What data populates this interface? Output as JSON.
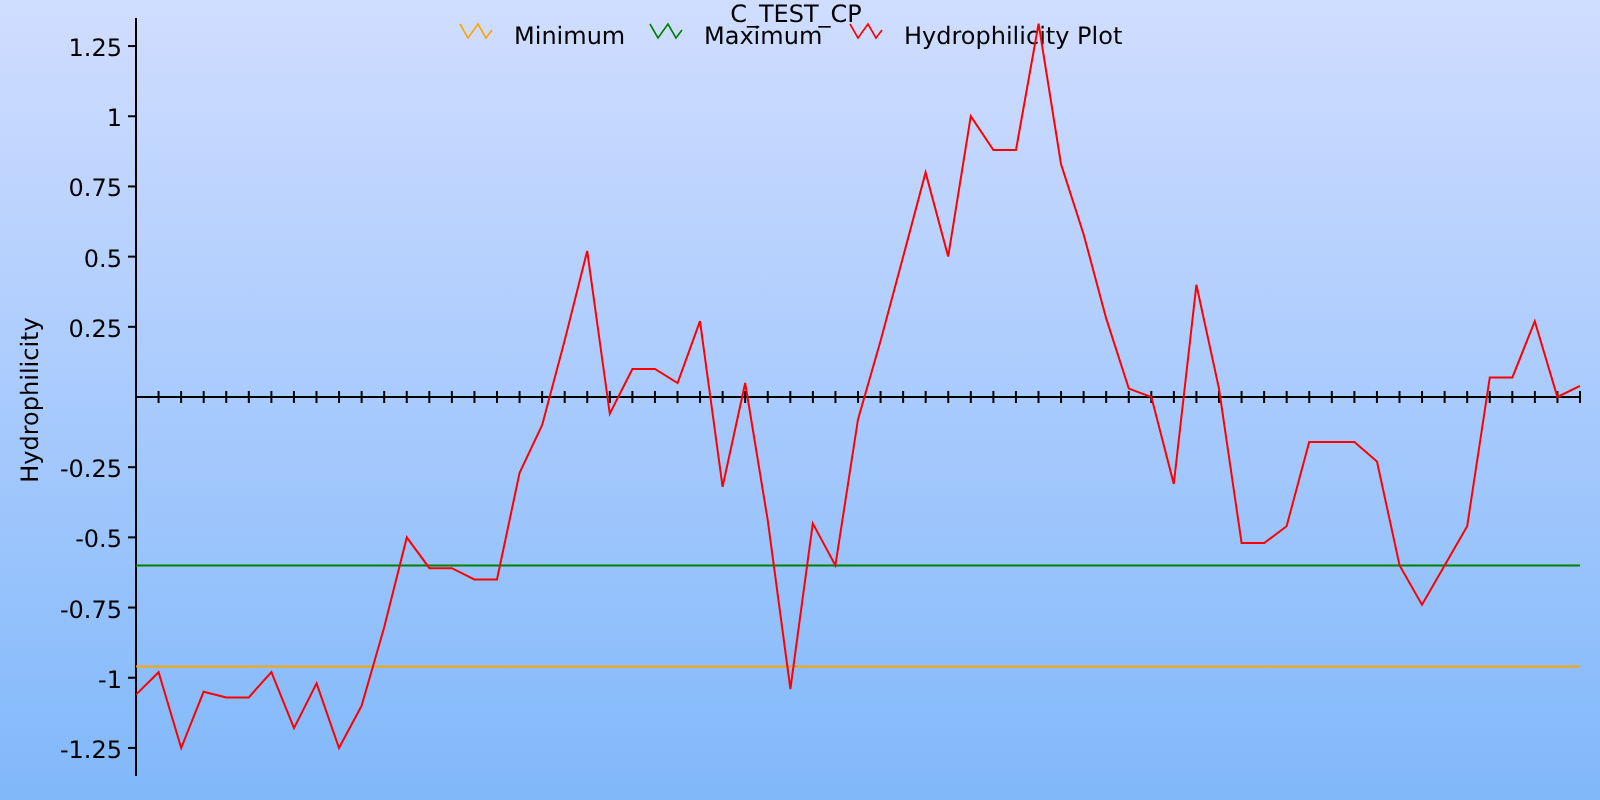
{
  "chart_data": {
    "type": "line",
    "title": "C_TEST_CP",
    "ylabel": "Hydrophilicity",
    "legend": "top",
    "ylim": [
      -1.35,
      1.35
    ],
    "yticks": [
      {
        "value": 1.25,
        "label": "1.25"
      },
      {
        "value": 1,
        "label": "1"
      },
      {
        "value": 0.75,
        "label": "0.75"
      },
      {
        "value": 0.5,
        "label": "0.5"
      },
      {
        "value": 0.25,
        "label": "0.25"
      },
      {
        "value": -0.25,
        "label": "-0.25"
      },
      {
        "value": -0.5,
        "label": "-0.5"
      },
      {
        "value": -0.75,
        "label": "-0.75"
      },
      {
        "value": -1,
        "label": "-1"
      },
      {
        "value": -1.25,
        "label": "-1.25"
      }
    ],
    "series": [
      {
        "name": "Minimum",
        "color": "#ffa500",
        "values": [
          -0.96,
          -0.96,
          -0.96,
          -0.96,
          -0.96,
          -0.96,
          -0.96,
          -0.96,
          -0.96,
          -0.96,
          -0.96,
          -0.96,
          -0.96,
          -0.96,
          -0.96,
          -0.96,
          -0.96,
          -0.96,
          -0.96,
          -0.96,
          -0.96,
          -0.96,
          -0.96,
          -0.96,
          -0.96,
          -0.96,
          -0.96,
          -0.96,
          -0.96,
          -0.96,
          -0.96,
          -0.96,
          -0.96,
          -0.96,
          -0.96,
          -0.96,
          -0.96,
          -0.96,
          -0.96,
          -0.96,
          -0.96,
          -0.96,
          -0.96,
          -0.96,
          -0.96,
          -0.96,
          -0.96,
          -0.96,
          -0.96,
          -0.96,
          -0.96,
          -0.96,
          -0.96,
          -0.96,
          -0.96,
          -0.96,
          -0.96,
          -0.96,
          -0.96,
          -0.96,
          -0.96,
          -0.96,
          -0.96,
          -0.96,
          -0.96
        ]
      },
      {
        "name": "Maximum",
        "color": "#008000",
        "values": [
          -0.6,
          -0.6,
          -0.6,
          -0.6,
          -0.6,
          -0.6,
          -0.6,
          -0.6,
          -0.6,
          -0.6,
          -0.6,
          -0.6,
          -0.6,
          -0.6,
          -0.6,
          -0.6,
          -0.6,
          -0.6,
          -0.6,
          -0.6,
          -0.6,
          -0.6,
          -0.6,
          -0.6,
          -0.6,
          -0.6,
          -0.6,
          -0.6,
          -0.6,
          -0.6,
          -0.6,
          -0.6,
          -0.6,
          -0.6,
          -0.6,
          -0.6,
          -0.6,
          -0.6,
          -0.6,
          -0.6,
          -0.6,
          -0.6,
          -0.6,
          -0.6,
          -0.6,
          -0.6,
          -0.6,
          -0.6,
          -0.6,
          -0.6,
          -0.6,
          -0.6,
          -0.6,
          -0.6,
          -0.6,
          -0.6,
          -0.6,
          -0.6,
          -0.6,
          -0.6,
          -0.6,
          -0.6,
          -0.6,
          -0.6,
          -0.6
        ]
      },
      {
        "name": "Hydrophilicity Plot",
        "color": "#ff0000",
        "values": [
          -1.06,
          -0.98,
          -1.25,
          -1.05,
          -1.07,
          -1.07,
          -0.98,
          -1.18,
          -1.02,
          -1.25,
          -1.1,
          -0.82,
          -0.5,
          -0.61,
          -0.61,
          -0.65,
          -0.65,
          -0.27,
          -0.1,
          0.2,
          0.52,
          -0.06,
          0.1,
          0.1,
          0.05,
          0.27,
          -0.32,
          0.05,
          -0.44,
          -1.04,
          -0.45,
          -0.6,
          -0.08,
          0.2,
          0.5,
          0.8,
          0.5,
          1.0,
          0.88,
          0.88,
          1.33,
          0.83,
          0.58,
          0.28,
          0.03,
          0,
          -0.31,
          0.4,
          0.03,
          -0.52,
          -0.52,
          -0.46,
          -0.16,
          -0.16,
          -0.16,
          -0.23,
          -0.6,
          -0.74,
          -0.6,
          -0.46,
          0.07,
          0.07,
          0.27,
          0,
          0.04
        ]
      }
    ]
  }
}
